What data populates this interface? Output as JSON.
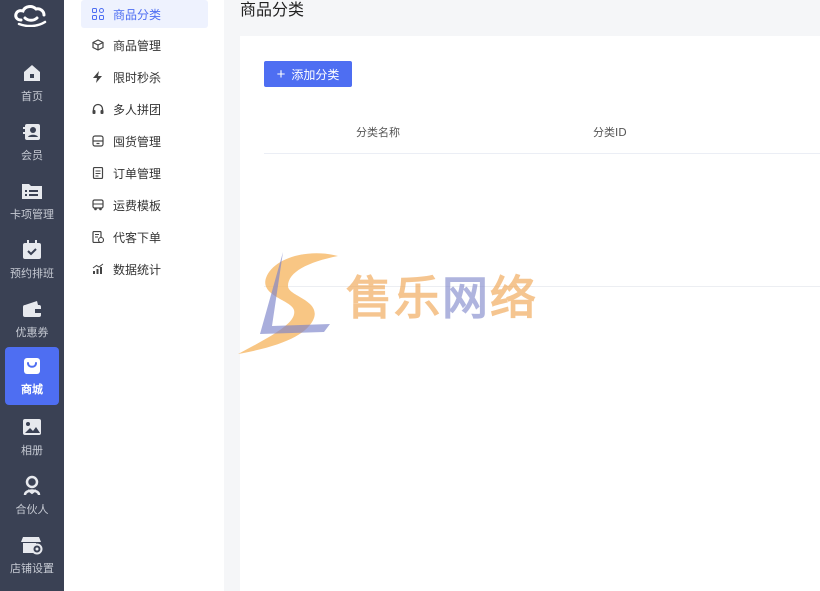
{
  "rail": {
    "items": [
      {
        "label": "首页",
        "icon": "home-icon"
      },
      {
        "label": "会员",
        "icon": "member-card-icon"
      },
      {
        "label": "卡项管理",
        "icon": "folder-list-icon"
      },
      {
        "label": "预约排班",
        "icon": "calendar-check-icon"
      },
      {
        "label": "优惠券",
        "icon": "wallet-icon"
      },
      {
        "label": "商城",
        "icon": "shopping-bag-icon",
        "active": true
      },
      {
        "label": "相册",
        "icon": "image-icon"
      },
      {
        "label": "合伙人",
        "icon": "partner-icon"
      },
      {
        "label": "店铺设置",
        "icon": "store-settings-icon"
      }
    ]
  },
  "submenu": {
    "items": [
      {
        "label": "商品分类",
        "icon": "grid-icon",
        "active": true
      },
      {
        "label": "商品管理",
        "icon": "box-icon"
      },
      {
        "label": "限时秒杀",
        "icon": "lightning-icon"
      },
      {
        "label": "多人拼团",
        "icon": "headset-icon"
      },
      {
        "label": "囤货管理",
        "icon": "storage-icon"
      },
      {
        "label": "订单管理",
        "icon": "order-doc-icon"
      },
      {
        "label": "运费模板",
        "icon": "truck-icon"
      },
      {
        "label": "代客下单",
        "icon": "order-form-icon"
      },
      {
        "label": "数据统计",
        "icon": "bar-chart-icon"
      }
    ]
  },
  "main": {
    "title": "商品分类",
    "add_button": "添加分类",
    "columns": [
      "分类名称",
      "分类ID"
    ]
  },
  "watermark": {
    "part1": "售乐",
    "part2": "网",
    "part3": "络"
  },
  "colors": {
    "accent": "#4e6ef2",
    "rail_bg": "#3a4154"
  }
}
